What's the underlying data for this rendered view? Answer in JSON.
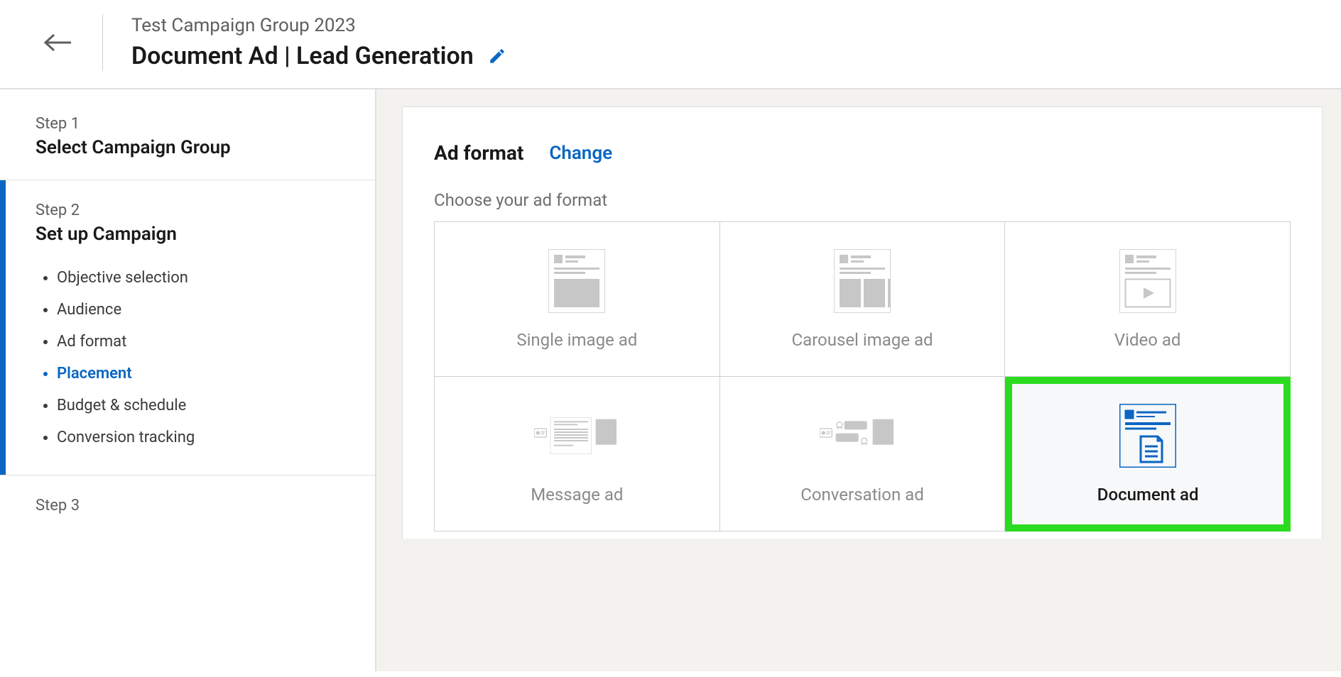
{
  "header": {
    "campaign_group": "Test Campaign Group 2023",
    "campaign_name": "Document Ad | Lead Generation"
  },
  "sidebar": {
    "steps": [
      {
        "label": "Step 1",
        "title": "Select Campaign Group"
      },
      {
        "label": "Step 2",
        "title": "Set up Campaign",
        "items": [
          "Objective selection",
          "Audience",
          "Ad format",
          "Placement",
          "Budget & schedule",
          "Conversion tracking"
        ],
        "current_index": 3
      },
      {
        "label": "Step 3",
        "title": ""
      }
    ]
  },
  "main": {
    "section_title": "Ad format",
    "change_label": "Change",
    "choose_label": "Choose your ad format",
    "formats": [
      {
        "id": "single-image",
        "label": "Single image ad",
        "selected": false
      },
      {
        "id": "carousel-image",
        "label": "Carousel image ad",
        "selected": false
      },
      {
        "id": "video",
        "label": "Video ad",
        "selected": false
      },
      {
        "id": "message",
        "label": "Message ad",
        "selected": false
      },
      {
        "id": "conversation",
        "label": "Conversation ad",
        "selected": false
      },
      {
        "id": "document",
        "label": "Document ad",
        "selected": true
      }
    ]
  },
  "colors": {
    "accent": "#0a66c2",
    "highlight": "#2bdb1f",
    "muted": "#c7c7c7"
  }
}
